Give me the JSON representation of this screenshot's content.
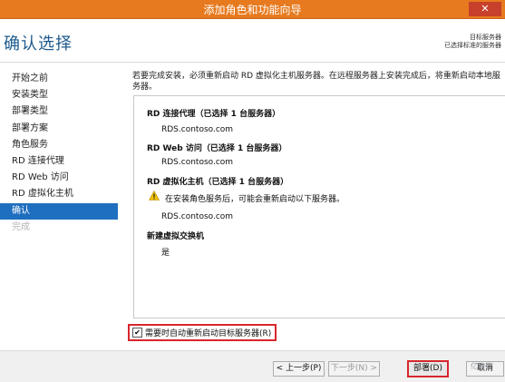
{
  "window": {
    "title": "添加角色和功能向导",
    "close_label": "✕"
  },
  "header": {
    "page_title": "确认选择",
    "target_label": "目标服务器",
    "target_value": "已选择标准的服务器"
  },
  "nav": {
    "items": [
      {
        "label": "开始之前"
      },
      {
        "label": "安装类型"
      },
      {
        "label": "部署类型"
      },
      {
        "label": "部署方案"
      },
      {
        "label": "角色服务"
      },
      {
        "label": "RD 连接代理"
      },
      {
        "label": "RD Web 访问"
      },
      {
        "label": "RD 虚拟化主机"
      },
      {
        "label": "确认"
      },
      {
        "label": "完成"
      }
    ],
    "active_index": 8
  },
  "main": {
    "intro": "若要完成安装，必须重新启动 RD 虚拟化主机服务器。在远程服务器上安装完成后，将重新启动本地服务器。",
    "sections": [
      {
        "heading": "RD 连接代理（已选择 1 台服务器）",
        "value": "RDS.contoso.com"
      },
      {
        "heading": "RD Web 访问（已选择 1 台服务器）",
        "value": "RDS.contoso.com"
      },
      {
        "heading": "RD 虚拟化主机（已选择 1 台服务器）",
        "value": "RDS.contoso.com"
      },
      {
        "heading": "新建虚拟交换机",
        "value": "是"
      }
    ],
    "warning": "在安装角色服务后，可能会重新启动以下服务器。",
    "restart_checkbox": {
      "label": "需要时自动重新启动目标服务器(R)",
      "checked": true,
      "mark": "✔"
    }
  },
  "footer": {
    "prev_label": "< 上一步(P)",
    "next_label": "下一步(N) >",
    "deploy_label": "部署(D)",
    "cancel_label": "取消",
    "watermark": "亿速云"
  },
  "colors": {
    "titlebar": "#e77a1e",
    "accent": "#1f6fc0",
    "highlight": "#d8262c"
  }
}
